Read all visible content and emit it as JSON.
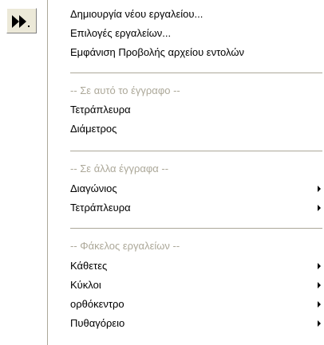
{
  "colors": {
    "button_face": "#ece9d8",
    "menu_background": "#ffffff",
    "disabled_text": "#aca899",
    "separator": "#aca899",
    "icon": "#000000"
  },
  "toolbar": {
    "button_icon": "fast-forward-icon"
  },
  "menu": {
    "item_create": "Δημιουργία νέου εργαλείου...",
    "item_options": "Επιλογές εργαλείων...",
    "item_show_command_view": "Εμφάνιση Προβολής αρχείου εντολών",
    "header_this_document": "-- Σε αυτό το έγγραφο --",
    "item_quad_this": "Τετράπλευρα",
    "item_diameter": "Διάμετρος",
    "header_other_documents": "-- Σε άλλα έγγραφα --",
    "item_diagonal": "Διαγώνιος",
    "item_quad_other": "Τετράπλευρα",
    "header_tool_folder": "-- Φάκελος εργαλείων --",
    "item_perpendiculars": "Κάθετες",
    "item_circles": "Κύκλοι",
    "item_orthocenter": "ορθόκεντρο",
    "item_pythagorean": "Πυθαγόρειο"
  }
}
